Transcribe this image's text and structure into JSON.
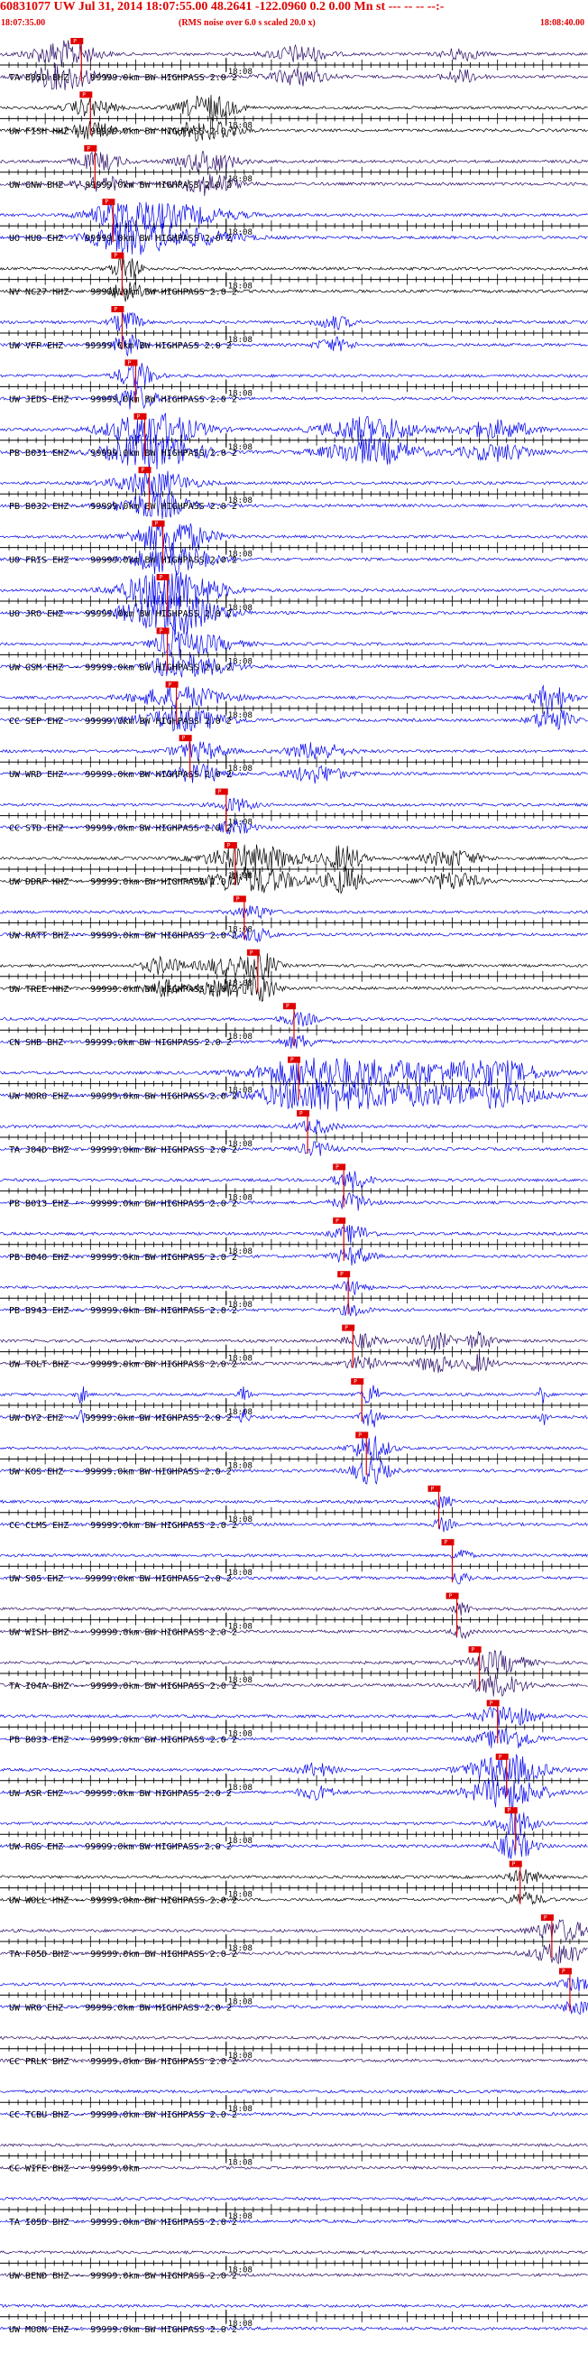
{
  "header": {
    "title": "60831077 UW Jul 31, 2014 18:07:55.00   48.2641 -122.0960  0.2 0.00 Mn st --- -- -- --:-",
    "start_time": "18:07:35.00",
    "note": "(RMS noise over 6.0 s scaled 20.0 x)",
    "end_time": "18:08:40.00"
  },
  "colors": {
    "blue": "#0000ee",
    "black": "#000000",
    "purple": "#2a0a66",
    "red": "#e00000",
    "grid": "#000000"
  },
  "time_marker_label": "18:08",
  "pick_label": "P",
  "chart_data": {
    "type": "seismogram",
    "x_unit": "seconds after 18:07:35.00",
    "xlim": [
      0,
      65
    ],
    "minute_tick_at": 25,
    "traces": [
      {
        "label": "TA B05D BHZ -- 99999.0km BW  HIGHPASS  2.0  2",
        "color": "purple",
        "pick_s": 9.0,
        "events": [
          [
            7,
            3.5,
            3
          ],
          [
            33,
            3,
            2
          ],
          [
            51,
            2,
            1.5
          ]
        ]
      },
      {
        "label": "UW FISH HHZ -- 99999.0km BW  HIGHPASS  2.0  2",
        "color": "black",
        "pick_s": 10.0,
        "events": [
          [
            10,
            2.5,
            2
          ],
          [
            23,
            3,
            3
          ]
        ]
      },
      {
        "label": "UW GNW BHZ -- 99999.0km BW  HIGHPASS  2.0  2",
        "color": "purple",
        "pick_s": 10.5,
        "events": [
          [
            11,
            2.5,
            2
          ],
          [
            23,
            3,
            2.5
          ]
        ]
      },
      {
        "label": "UO HUO EHZ -- 99999.0km BW  HIGHPASS  2.0  2",
        "color": "blue",
        "pick_s": 12.5,
        "events": [
          [
            14,
            4,
            3
          ],
          [
            20,
            6,
            2
          ]
        ]
      },
      {
        "label": "NV NC27 HHZ -- 99999.0km BW  HIGHPASS  2.0  2",
        "color": "black",
        "pick_s": 13.5,
        "events": [
          [
            14,
            1.5,
            3
          ]
        ]
      },
      {
        "label": "UW VFP EHZ -- 99999.0km BW  HIGHPASS  2.0  2",
        "color": "blue",
        "pick_s": 13.5,
        "events": [
          [
            14,
            1.5,
            2.5
          ],
          [
            37,
            2,
            1.5
          ]
        ]
      },
      {
        "label": "UW JEDS EHZ -- 99999.0km BW  HIGHPASS  2.0  2",
        "color": "blue",
        "pick_s": 15.0,
        "events": [
          [
            15,
            2,
            3
          ]
        ]
      },
      {
        "label": "PB B031 EHZ -- 99999.0km BW  HIGHPASS  2.0  2",
        "color": "blue",
        "pick_s": 16.0,
        "events": [
          [
            17,
            5,
            4
          ],
          [
            41,
            5,
            3
          ],
          [
            55,
            4,
            2
          ]
        ]
      },
      {
        "label": "PB B032 EHZ -- 99999.0km BW  HIGHPASS  2.0  2",
        "color": "blue",
        "pick_s": 16.5,
        "events": [
          [
            17,
            4,
            3
          ]
        ]
      },
      {
        "label": "UO FRIS EHZ -- 99999.0km BW  HIGHPASS  2.0  2",
        "color": "blue",
        "pick_s": 18.0,
        "events": [
          [
            19,
            4,
            4
          ]
        ]
      },
      {
        "label": "UO JRO EHZ -- 99999.0km BW  HIGHPASS  2.0  2",
        "color": "blue",
        "pick_s": 18.5,
        "events": [
          [
            19,
            5,
            5
          ]
        ]
      },
      {
        "label": "UW GSM EHZ -- 99999.0km BW  HIGHPASS  2.0  2",
        "color": "blue",
        "pick_s": 18.5,
        "events": [
          [
            19,
            2,
            2
          ],
          [
            22,
            4,
            2
          ]
        ]
      },
      {
        "label": "CC SEP EHZ -- 99999.0km BW  HIGHPASS  2.0  2",
        "color": "blue",
        "pick_s": 19.5,
        "events": [
          [
            20,
            5,
            2.5
          ],
          [
            61,
            2,
            3
          ]
        ]
      },
      {
        "label": "UW WRD EHZ -- 99999.0km BW  HIGHPASS  2.0  2",
        "color": "blue",
        "pick_s": 21.0,
        "events": [
          [
            22,
            3,
            2
          ],
          [
            35,
            3,
            2
          ]
        ]
      },
      {
        "label": "CC STD EHZ -- 99999.0km BW  HIGHPASS  2.0  2",
        "color": "blue",
        "pick_s": 25.0,
        "events": [
          [
            26,
            2,
            1.5
          ]
        ]
      },
      {
        "label": "UW DDRF HHZ -- 99999.0km BW  HIGHPASS  2.0  2",
        "color": "black",
        "pick_s": 26.0,
        "events": [
          [
            28,
            5,
            3
          ],
          [
            38,
            2,
            3
          ],
          [
            50,
            3,
            2
          ]
        ]
      },
      {
        "label": "UW RATT BHZ -- 99999.0km BW  HIGHPASS  2.0  2",
        "color": "blue",
        "pick_s": 27.0,
        "events": [
          [
            28,
            2,
            1.5
          ]
        ]
      },
      {
        "label": "UW TREE HHZ -- 99999.0km BW  HIGHPASS  2.0  2",
        "color": "black",
        "pick_s": 28.5,
        "events": [
          [
            18,
            2,
            2
          ],
          [
            25,
            3,
            2
          ],
          [
            29,
            1.5,
            3
          ]
        ]
      },
      {
        "label": "CN SHB BHZ -- 99999.0km BW  HIGHPASS  2.0  2",
        "color": "blue",
        "pick_s": 32.5,
        "events": [
          [
            33,
            2,
            1.5
          ]
        ]
      },
      {
        "label": "UW MORO EHZ -- 99999.0km BW  HIGHPASS  2.0  2",
        "color": "blue",
        "pick_s": 33.0,
        "events": [
          [
            34,
            6,
            3
          ],
          [
            44,
            8,
            2.5
          ],
          [
            55,
            5,
            2.5
          ]
        ]
      },
      {
        "label": "TA J04D BHZ -- 99999.0km BW  HIGHPASS  2.0  2",
        "color": "blue",
        "pick_s": 34.0,
        "events": [
          [
            35,
            2,
            1.5
          ]
        ]
      },
      {
        "label": "PB B013 EHZ -- 99999.0km BW  HIGHPASS  2.0  2",
        "color": "blue",
        "pick_s": 38.0,
        "events": [
          [
            39,
            2,
            2
          ]
        ]
      },
      {
        "label": "PB B040 EHZ -- 99999.0km BW  HIGHPASS  2.0  2",
        "color": "blue",
        "pick_s": 38.0,
        "events": [
          [
            39,
            2,
            2
          ]
        ]
      },
      {
        "label": "PB B943 EHZ -- 99999.0km BW  HIGHPASS  2.0  2",
        "color": "blue",
        "pick_s": 38.5,
        "events": [
          [
            39,
            1.5,
            1.5
          ]
        ]
      },
      {
        "label": "UW TOLT BHZ -- 99999.0km BW  HIGHPASS  2.0  2",
        "color": "purple",
        "pick_s": 39.0,
        "events": [
          [
            40,
            2,
            1.5
          ],
          [
            48,
            2,
            2
          ],
          [
            53,
            1.5,
            2
          ]
        ]
      },
      {
        "label": "UW DY2 EHZ -- 99999.0km BW  HIGHPASS  2.0  2",
        "color": "blue",
        "pick_s": 40.0,
        "events": [
          [
            9,
            0.5,
            2
          ],
          [
            27,
            0.5,
            2
          ],
          [
            41,
            1,
            2.5
          ],
          [
            60,
            0.5,
            2
          ]
        ]
      },
      {
        "label": "UW KOS EHZ -- 99999.0km BW  HIGHPASS  2.0  2",
        "color": "blue",
        "pick_s": 40.5,
        "events": [
          [
            41,
            2,
            3
          ]
        ]
      },
      {
        "label": "CC CLMS EHZ -- 99999.0km BW  HIGHPASS  2.0  2",
        "color": "blue",
        "pick_s": 48.5,
        "events": [
          [
            49,
            1,
            1.5
          ]
        ]
      },
      {
        "label": "UW SOS EHZ -- 99999.0km BW  HIGHPASS  2.0  2",
        "color": "blue",
        "pick_s": 50.0,
        "events": [
          [
            51,
            1,
            1.5
          ]
        ]
      },
      {
        "label": "UW WISH BHZ -- 99999.0km BW  HIGHPASS  2.0  2",
        "color": "purple",
        "pick_s": 50.5,
        "events": [
          [
            51,
            1,
            1.5
          ]
        ]
      },
      {
        "label": "TA I04A BHZ -- 99999.0km BW  HIGHPASS  2.0  2",
        "color": "purple",
        "pick_s": 53.0,
        "events": [
          [
            55,
            3,
            2.5
          ]
        ]
      },
      {
        "label": "PB B033 EHZ -- 99999.0km BW  HIGHPASS  2.0  2",
        "color": "blue",
        "pick_s": 55.0,
        "events": [
          [
            56,
            3,
            2.5
          ]
        ]
      },
      {
        "label": "UW ASR EHZ -- 99999.0km BW  HIGHPASS  2.0  2",
        "color": "blue",
        "pick_s": 56.0,
        "events": [
          [
            56,
            4,
            3.5
          ],
          [
            35,
            2,
            1.5
          ]
        ]
      },
      {
        "label": "UW RGS EHZ -- 99999.0km BW  HIGHPASS  2.0  2",
        "color": "blue",
        "pick_s": 57.0,
        "events": [
          [
            57,
            2,
            3
          ]
        ]
      },
      {
        "label": "UW WOLL HHZ -- 99999.0km BW  HIGHPASS  2.0  2",
        "color": "black",
        "pick_s": 57.5,
        "events": [
          [
            58,
            2,
            1.5
          ]
        ]
      },
      {
        "label": "TA F05D BHZ -- 99999.0km BW  HIGHPASS  2.0  2",
        "color": "purple",
        "pick_s": 61.0,
        "events": [
          [
            62,
            3,
            2.5
          ]
        ]
      },
      {
        "label": "UW WRO EHZ -- 99999.0km BW  HIGHPASS  2.0  2",
        "color": "blue",
        "pick_s": 63.0,
        "events": [
          [
            64,
            2,
            1.5
          ]
        ]
      },
      {
        "label": "CC PRLK BHZ -- 99999.0km BW  HIGHPASS  2.0  2",
        "color": "purple",
        "pick_s": null,
        "events": []
      },
      {
        "label": "CC TCBU BHZ -- 99999.0km BW  HIGHPASS  2.0  2",
        "color": "blue",
        "pick_s": null,
        "events": []
      },
      {
        "label": "CC WIFE BHZ -- 99999.0km",
        "color": "purple",
        "pick_s": null,
        "events": []
      },
      {
        "label": "TA I05D BHZ -- 99999.0km BW  HIGHPASS  2.0  2",
        "color": "blue",
        "pick_s": null,
        "events": []
      },
      {
        "label": "UW BEND BHZ -- 99999.0km BW  HIGHPASS  2.0  2",
        "color": "purple",
        "pick_s": null,
        "events": []
      },
      {
        "label": "UW MOON EHZ -- 99999.0km BW  HIGHPASS  2.0  2",
        "color": "blue",
        "pick_s": null,
        "events": []
      }
    ]
  }
}
